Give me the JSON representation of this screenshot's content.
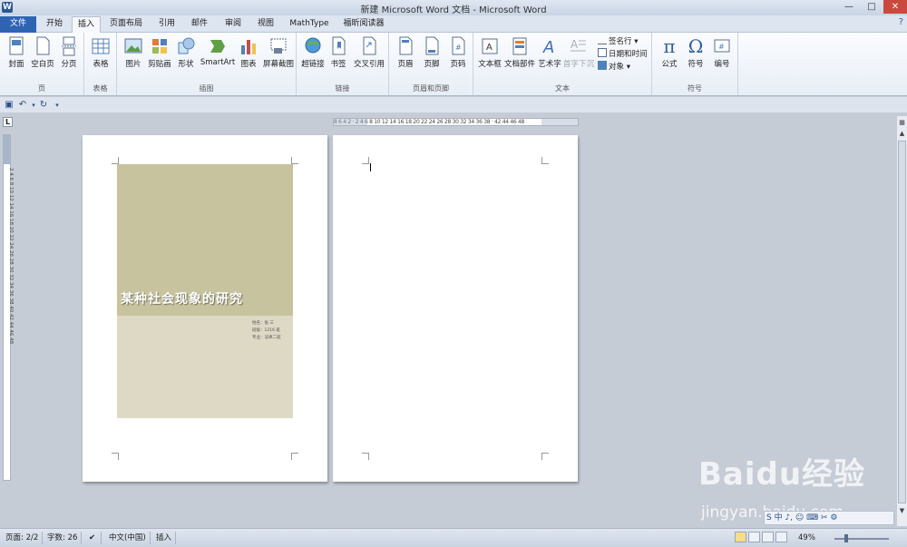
{
  "window": {
    "title": "新建 Microsoft Word 文档 - Microsoft Word",
    "app_icon": "W",
    "help_glyph": "?"
  },
  "tabs": [
    {
      "label": "文件",
      "active": false
    },
    {
      "label": "开始",
      "active": false
    },
    {
      "label": "插入",
      "active": true
    },
    {
      "label": "页面布局",
      "active": false
    },
    {
      "label": "引用",
      "active": false
    },
    {
      "label": "邮件",
      "active": false
    },
    {
      "label": "审阅",
      "active": false
    },
    {
      "label": "视图",
      "active": false
    },
    {
      "label": "MathType",
      "active": false
    },
    {
      "label": "福昕阅读器",
      "active": false
    }
  ],
  "ribbon": {
    "groups": {
      "page": "页",
      "table": "表格",
      "illustrations": "插图",
      "links": "链接",
      "header_footer": "页眉和页脚",
      "text": "文本",
      "symbols": "符号"
    },
    "buttons": {
      "cover": "封面",
      "blank_page": "空白页",
      "page_break": "分页",
      "table": "表格",
      "picture": "图片",
      "clipart": "剪贴画",
      "shapes": "形状",
      "smartart": "SmartArt",
      "chart": "图表",
      "screenshot": "屏幕截图",
      "hyperlink": "超链接",
      "bookmark": "书签",
      "cross_reference": "交叉引用",
      "header": "页眉",
      "footer": "页脚",
      "page_number": "页码",
      "text_box": "文本框",
      "quick_parts": "文档部件",
      "wordart": "艺术字",
      "drop_cap": "首字下沉",
      "signature_line": "签名行",
      "date_time": "日期和时间",
      "object": "对象",
      "equation": "公式",
      "symbol": "符号",
      "number": "编号"
    }
  },
  "ruler": {
    "corner": "L",
    "horizontal_ticks": "8  6  4  2  ·  2  4  6  8  10  12  14  16  18  20  22  24  26  28  30  32  34  36  38  ·  42  44  46  48",
    "vertical_ticks": "2  4  6  8  10  12  14  16  18  20  22  24  26  28  30  32  34  36  38  40  42  44  46  48"
  },
  "document": {
    "cover_title": "某种社会现象的研究",
    "cover_info": [
      "姓名：张  三",
      "班级：1216 班",
      "专业：法律二班"
    ]
  },
  "statusbar": {
    "page": "页面: 2/2",
    "words": "字数: 26",
    "language": "中文(中国)",
    "mode": "插入",
    "zoom": "49%"
  },
  "watermark": {
    "main": "Baidu经验",
    "sub": "jingyan.baidu.com"
  },
  "ime": {
    "label": "S 中 ♪, ☺ ⌨ ✂ ⚙"
  },
  "colors": {
    "file_tab": "#2f64b3",
    "cover_dark": "#c7c39e",
    "cover_light": "#ddd9c4"
  }
}
